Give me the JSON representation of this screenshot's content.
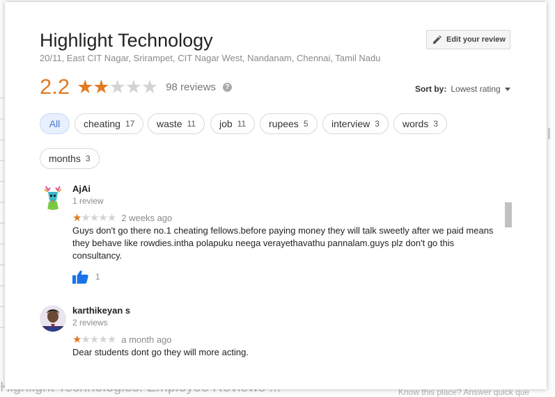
{
  "background": {
    "bottom_left": "Highlight Technologies: Employee Reviews ...",
    "bottom_right": "Know this place? Answer quick que",
    "right_char": "l"
  },
  "place": {
    "name": "Highlight Technology",
    "address": "20/11, East CIT Nagar, Srirampet, CIT Nagar West, Nandanam, Chennai, Tamil Nadu"
  },
  "edit_button": {
    "label": "Edit your review",
    "icon": "pencil-icon"
  },
  "rating": {
    "value": "2.2",
    "stars_filled": 2,
    "stars_total": 5,
    "reviews_label": "98 reviews",
    "help_icon": "question-icon"
  },
  "sort": {
    "label": "Sort by:",
    "value": "Lowest rating"
  },
  "chips": [
    {
      "label": "All",
      "count": "",
      "active": true
    },
    {
      "label": "cheating",
      "count": "17"
    },
    {
      "label": "waste",
      "count": "11"
    },
    {
      "label": "job",
      "count": "11"
    },
    {
      "label": "rupees",
      "count": "5"
    },
    {
      "label": "interview",
      "count": "3"
    },
    {
      "label": "words",
      "count": "3"
    },
    {
      "label": "months",
      "count": "3"
    }
  ],
  "reviews": [
    {
      "name": "AjAi",
      "review_count": "1 review",
      "stars": 1,
      "date": "2 weeks ago",
      "text": "Guys don't go there no.1 cheating fellows.before paying money they will talk sweetly after we paid means they behave like rowdies.intha polapuku neega verayethavathu pannalam.guys plz don't go this consultancy.",
      "likes": "1"
    },
    {
      "name": "karthikeyan s",
      "review_count": "2 reviews",
      "stars": 1,
      "date": "a month ago",
      "text": "Dear students dont go they  will more acting."
    }
  ],
  "colors": {
    "accent": "#e17a22",
    "like_blue": "#1a73e8",
    "chip_active": "#e8f0fe"
  }
}
